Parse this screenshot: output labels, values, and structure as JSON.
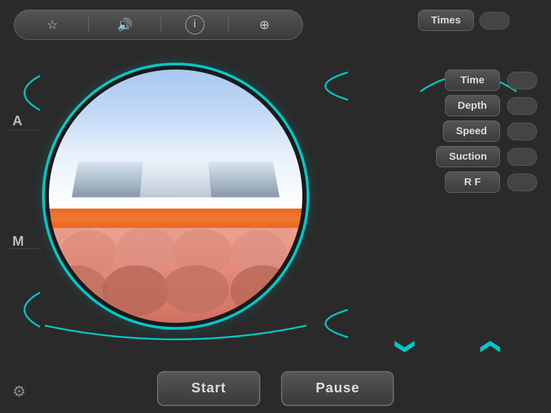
{
  "toolbar": {
    "star_icon": "☆",
    "volume_icon": "🔊",
    "info_icon": "ℹ",
    "plus_circle_icon": "⊕"
  },
  "header": {
    "times_label": "Times"
  },
  "labels": {
    "a": "A",
    "m": "M"
  },
  "params": [
    {
      "id": "time",
      "label": "Time"
    },
    {
      "id": "depth",
      "label": "Depth"
    },
    {
      "id": "speed",
      "label": "Speed"
    },
    {
      "id": "suction",
      "label": "Suction"
    },
    {
      "id": "rf",
      "label": "R F"
    }
  ],
  "nav": {
    "down_arrow": "❯",
    "up_arrow": "❯"
  },
  "bottom": {
    "settings_icon": "⚙",
    "start_label": "Start",
    "pause_label": "Pause"
  }
}
